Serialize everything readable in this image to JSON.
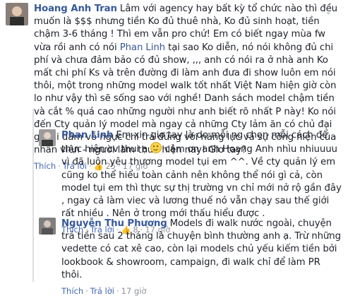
{
  "comments": [
    {
      "author": "Hoang Anh Tran",
      "text": "Lâm với agency hay bất kỳ tổ chức nào thì đều muốn là $$$ nhưng tiền Ko đủ thuê nhà, Ko đủ sinh hoạt, tiền chậm 3-6 tháng ! Thì em vẫn pro chứ! Em có biết ngay mùa fw vừa rồi anh có nói ",
      "mention": "Phan Linh",
      "text_after": " tại sao Ko diễn, nó nói không đủ chi phí và chưa đảm bảo có đủ show, ,,, anh có nói ra ở nhà anh Ko mất chi phí Ks và trên đường đi làm anh đưa đi show luôn em nói thôi, một trong những model walk tốt nhất Việt Nam hiện giờ còn lo như vậy thì sẽ sống sao với nghề! Danh sách model chậm tiền và cắt % quá cao những người như anh biết rõ nhất P này! Ko nói đến Cty quản lý model mà ngay cả những Cty lảm ăn có chủ đại gia ai dám vỗ ngực chi trả đúng với năng lực và sự cống hiện của nhân viên - người làm thuê hiện nay! Giơ tay?",
      "like": "Thích",
      "reply": "Trả lời",
      "likes": "25",
      "time": "17 giờ"
    },
    {
      "author": "Phan Linh",
      "text_before_emoji": "Em xin giơ tay là do mỗi ng chọn mỗi cách để thực hiện cv thui ạ ",
      "text_after_emoji": " cảm ơn anh Hoang Anh nhìu nhiuuuu vì đã luôn yêu thương model tụi em ^^. Về cty quản lý em cũng ko thể hiểu toàn cảnh nên không thể nói gì cả, còn model tụi em thì thực sự thị trường vn chỉ mới nở rộ gần đây , ngay cả làm viec và lương thuế nó vẫn chạy sau thế giới rất nhiều . Nên ở trong mới thấu hiểu được .",
      "like": "Thích",
      "reply": "Trả lời",
      "likes": "8",
      "time": "17 giờ"
    },
    {
      "author": "Nguyễn Thu Phương",
      "text": "Models đi walk nước ngoài, chuyện trả tiền sau 2 tháng là chuyện bình thường anh ạ. Trừ những vedette có cat xê cao, còn lại models chủ yếu kiếm tiền bởi lookbook & showroom, campaign, đi walk chỉ để làm PR thôi.",
      "like": "Thích",
      "reply": "Trả lời",
      "likes": "",
      "time": "17 giờ"
    }
  ],
  "icons": {
    "like": "thumbs-up-icon",
    "chevron": "chevron-down-icon",
    "emoji": "smile-emoji-icon"
  }
}
